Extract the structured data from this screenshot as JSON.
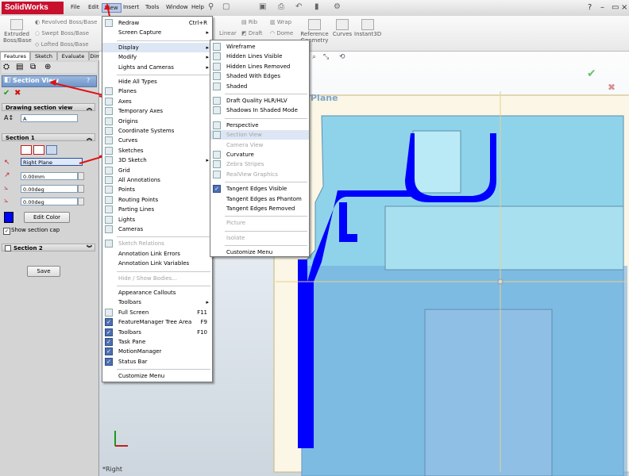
{
  "app": {
    "logo": "SolidWorks",
    "menubar": [
      "File",
      "Edit",
      "View",
      "Insert",
      "Tools",
      "Window",
      "Help"
    ]
  },
  "toolbar": {
    "extruded": "Extruded Boss/Base",
    "revolved": "Revolved Boss/Base",
    "swept": "Swept Boss/Base",
    "lofted": "Lofted Boss/Base",
    "rib": "Rib",
    "wrap": "Wrap",
    "linear": "Linear",
    "draft": "Draft",
    "dome": "Dome",
    "reference_geometry": "Reference Geometry",
    "curves": "Curves",
    "instant3d": "Instant3D"
  },
  "tabs": [
    "Features",
    "Sketch",
    "Evaluate",
    "Dim"
  ],
  "property_manager": {
    "title": "Section View",
    "help": "?",
    "drawing_section_view_label": "Drawing section view",
    "name_value": "A",
    "section1_label": "Section 1",
    "plane_value": "Right Plane",
    "offset_value": "0.00mm",
    "angle1_value": "0.00deg",
    "angle2_value": "0.00deg",
    "edit_color_label": "Edit Color",
    "show_section_cap_label": "Show section cap",
    "section2_label": "Section 2",
    "save_label": "Save"
  },
  "view_menu": [
    {
      "label": "Redraw",
      "shortcut": "Ctrl+R",
      "icon": "redraw-icon"
    },
    {
      "label": "Screen Capture",
      "submenu": true
    },
    {
      "sep": true
    },
    {
      "label": "Display",
      "submenu": true,
      "highlight": true
    },
    {
      "label": "Modify",
      "submenu": true
    },
    {
      "label": "Lights and Cameras",
      "submenu": true
    },
    {
      "sep": true
    },
    {
      "label": "Hide All Types"
    },
    {
      "label": "Planes",
      "icon": "planes-icon"
    },
    {
      "label": "Axes",
      "icon": "axes-icon"
    },
    {
      "label": "Temporary Axes",
      "icon": "temporary-axes-icon"
    },
    {
      "label": "Origins",
      "icon": "origins-icon"
    },
    {
      "label": "Coordinate Systems",
      "icon": "coordinate-systems-icon"
    },
    {
      "label": "Curves",
      "icon": "curves-icon"
    },
    {
      "label": "Sketches",
      "icon": "sketches-icon"
    },
    {
      "label": "3D Sketch",
      "icon": "3dsketch-icon",
      "submenu": true
    },
    {
      "label": "Grid",
      "icon": "grid-icon"
    },
    {
      "label": "All Annotations",
      "icon": "annotations-icon"
    },
    {
      "label": "Points",
      "icon": "points-icon"
    },
    {
      "label": "Routing Points",
      "icon": "routing-points-icon"
    },
    {
      "label": "Parting Lines",
      "icon": "parting-lines-icon"
    },
    {
      "label": "Lights",
      "icon": "lights-icon"
    },
    {
      "label": "Cameras",
      "icon": "cameras-icon"
    },
    {
      "sep": true
    },
    {
      "label": "Sketch Relations",
      "disabled": true,
      "icon": "sketch-relations-icon"
    },
    {
      "label": "Annotation Link Errors"
    },
    {
      "label": "Annotation Link Variables"
    },
    {
      "sep": true
    },
    {
      "label": "Hide / Show Bodies...",
      "disabled": true
    },
    {
      "sep": true
    },
    {
      "label": "Appearance Callouts"
    },
    {
      "label": "Toolbars",
      "submenu": true
    },
    {
      "label": "Full Screen",
      "shortcut": "F11",
      "icon": "fullscreen-icon"
    },
    {
      "label": "FeatureManager Tree Area",
      "shortcut": "F9",
      "checked": true
    },
    {
      "label": "Toolbars",
      "shortcut": "F10",
      "checked": true
    },
    {
      "label": "Task Pane",
      "checked": true
    },
    {
      "label": "MotionManager",
      "checked": true
    },
    {
      "label": "Status Bar",
      "checked": true
    },
    {
      "sep": true
    },
    {
      "label": "Customize Menu"
    }
  ],
  "display_submenu": [
    {
      "label": "Wireframe",
      "icon": "wireframe-icon"
    },
    {
      "label": "Hidden Lines Visible",
      "icon": "hidden-lines-visible-icon"
    },
    {
      "label": "Hidden Lines Removed",
      "icon": "hidden-lines-removed-icon"
    },
    {
      "label": "Shaded With Edges",
      "icon": "shaded-with-edges-icon"
    },
    {
      "label": "Shaded",
      "icon": "shaded-icon"
    },
    {
      "sep": true
    },
    {
      "label": "Draft Quality HLR/HLV",
      "icon": "draft-quality-icon"
    },
    {
      "label": "Shadows In Shaded Mode",
      "icon": "shadows-icon"
    },
    {
      "sep": true
    },
    {
      "label": "Perspective",
      "icon": "perspective-icon"
    },
    {
      "label": "Section View",
      "icon": "section-view-icon",
      "highlight": true,
      "disabled": true
    },
    {
      "label": "Camera View",
      "disabled": true
    },
    {
      "label": "Curvature",
      "icon": "curvature-icon"
    },
    {
      "label": "Zebra Stripes",
      "disabled": true,
      "icon": "zebra-stripes-icon"
    },
    {
      "label": "RealView Graphics",
      "disabled": true,
      "icon": "realview-icon"
    },
    {
      "sep": true
    },
    {
      "label": "Tangent Edges Visible",
      "checked": true
    },
    {
      "label": "Tangent Edges as Phantom"
    },
    {
      "label": "Tangent Edges Removed"
    },
    {
      "sep": true
    },
    {
      "label": "Picture",
      "disabled": true
    },
    {
      "sep": true
    },
    {
      "label": "Isolate",
      "disabled": true
    },
    {
      "sep": true
    },
    {
      "label": "Customize Menu"
    }
  ],
  "graphics": {
    "plane_label": "Plane",
    "view_label": "*Right"
  },
  "colors": {
    "section_cap": "#0000ff",
    "part_face": "#8fd3ea",
    "part_dark": "#6fa8dc",
    "arrow": "#e01010"
  }
}
